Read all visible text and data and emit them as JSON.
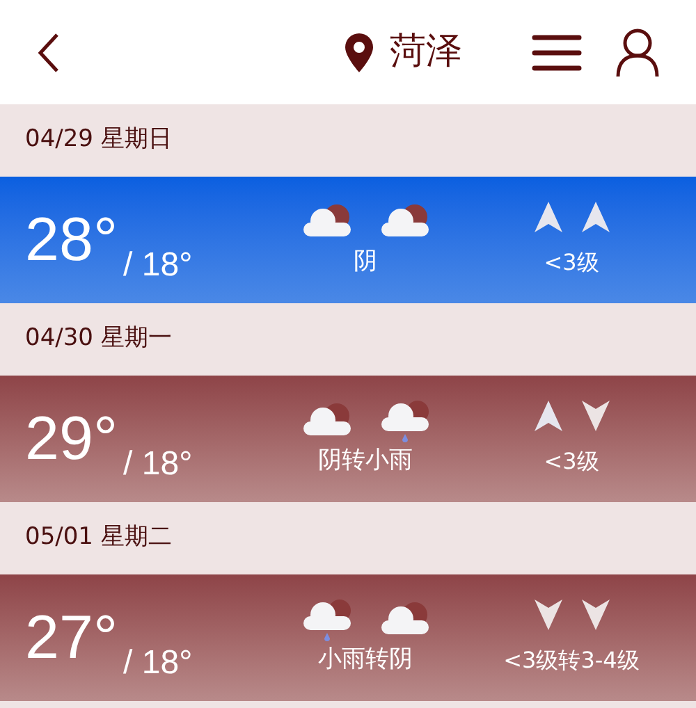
{
  "header": {
    "city": "菏泽"
  },
  "days": [
    {
      "date": "04/29 星期日",
      "selected": true,
      "high": "28°",
      "low": "/ 18°",
      "condition": "阴",
      "icons": [
        {
          "kind": "cloudy"
        },
        {
          "kind": "cloudy"
        }
      ],
      "arrows": [
        {
          "kind": "up"
        },
        {
          "kind": "up"
        }
      ],
      "wind": "<3级"
    },
    {
      "date": "04/30 星期一",
      "selected": false,
      "high": "29°",
      "low": "/ 18°",
      "condition": "阴转小雨",
      "icons": [
        {
          "kind": "cloudy"
        },
        {
          "kind": "rain"
        }
      ],
      "arrows": [
        {
          "kind": "up"
        },
        {
          "kind": "down"
        }
      ],
      "wind": "<3级"
    },
    {
      "date": "05/01 星期二",
      "selected": false,
      "high": "27°",
      "low": "/ 18°",
      "condition": "小雨转阴",
      "icons": [
        {
          "kind": "rain"
        },
        {
          "kind": "cloudy"
        }
      ],
      "arrows": [
        {
          "kind": "down"
        },
        {
          "kind": "down"
        }
      ],
      "wind": "<3级转3-4级"
    }
  ]
}
